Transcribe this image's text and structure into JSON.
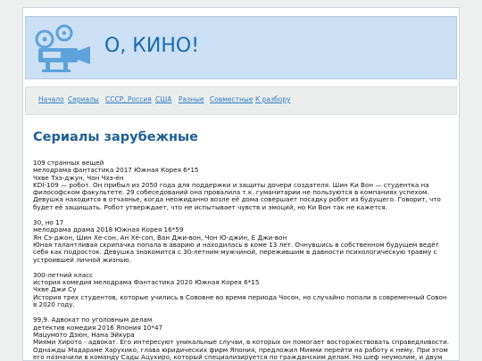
{
  "site": {
    "title": "О, КИНО!"
  },
  "nav": [
    {
      "label": "Начало"
    },
    {
      "label": "Сериалы"
    },
    {
      "label": "СССР, Россия"
    },
    {
      "label": "США"
    },
    {
      "label": "Разные"
    },
    {
      "label": "Совместные"
    },
    {
      "label": "К разбору"
    }
  ],
  "section_title": "Сериалы зарубежные",
  "items": [
    {
      "title": "109 странных вещей",
      "meta": "мелодрама фантастика 2017 Южная Корея 6*15",
      "cast": "Чхве Тхэ-джун, Чон Чхэ-ён",
      "desc": "KDI-109 — робот. Он прибыл из 2050 года для поддержки и защиты дочери создателя. Шин Ки Вон — студентка на философском факультете. 29 собеседований она провалила т.к. гуманитарии не пользуются в компаниях успехом. Девушка находится в отчаянье, когда неожиданно возле её дома совершает посадку робот из будущего. Говорит, что будет её защищать. Робот утверждает, что не испытывает чувств и эмоций, но Ки Вон так не кажется."
    },
    {
      "title": "30, но 17",
      "meta": "мелодрама драма 2018 Южная Корея 16*59",
      "cast": "Ян Сэ-джон, Шин Хе-сон, Ан Хё-соп, Ван Джи-вон, Чон Ю-джин, Е Джи-вон",
      "desc": "Юная талантливая скрипачка попала в аварию и находилась в коме 13 лет. Очнувшись в собственном будущем ведёт себя как подросток. Девушка знакомится с 30-летним мужчиной, пережившим в давности психологическую травму с устроившей личной жизнью."
    },
    {
      "title": "300-летний класс",
      "meta": "история комедия мелодрама Фантастика 2020 Южная Корея 6*15",
      "cast": "Чхве Джи Су",
      "desc": "История трех студентов, которые учились в Сововне во время периода Чосон, но случайно попали в современный Совон в 2020 году."
    },
    {
      "title": "99,9. Адвокат по уголовным делам",
      "meta": "детектив комедия 2016 Япония 10*47",
      "cast": "Мацумото Дзюн, Нана Эйкура",
      "desc": "Миями Хирото - адвокат. Его интересуют уникальные случаи, в которых он помогает восторжествовать справедливости. Однажды Мадараме Харухико, глава юридических фирм Япония, предложил Миями перейти на работу к нему. При этом его назначили в команду Сады Ацухиро, который специализируется по гражданским делам. Но шеф неумолим, и двум антиподам придётся найти точки соприкосновения."
    }
  ],
  "colors": {
    "header_bg": "#cbe0f4",
    "accent": "#1a6ab0",
    "link": "#2b7bc0",
    "logo": "#5ea2dc"
  },
  "icons": {
    "logo": "film-projector-icon"
  }
}
